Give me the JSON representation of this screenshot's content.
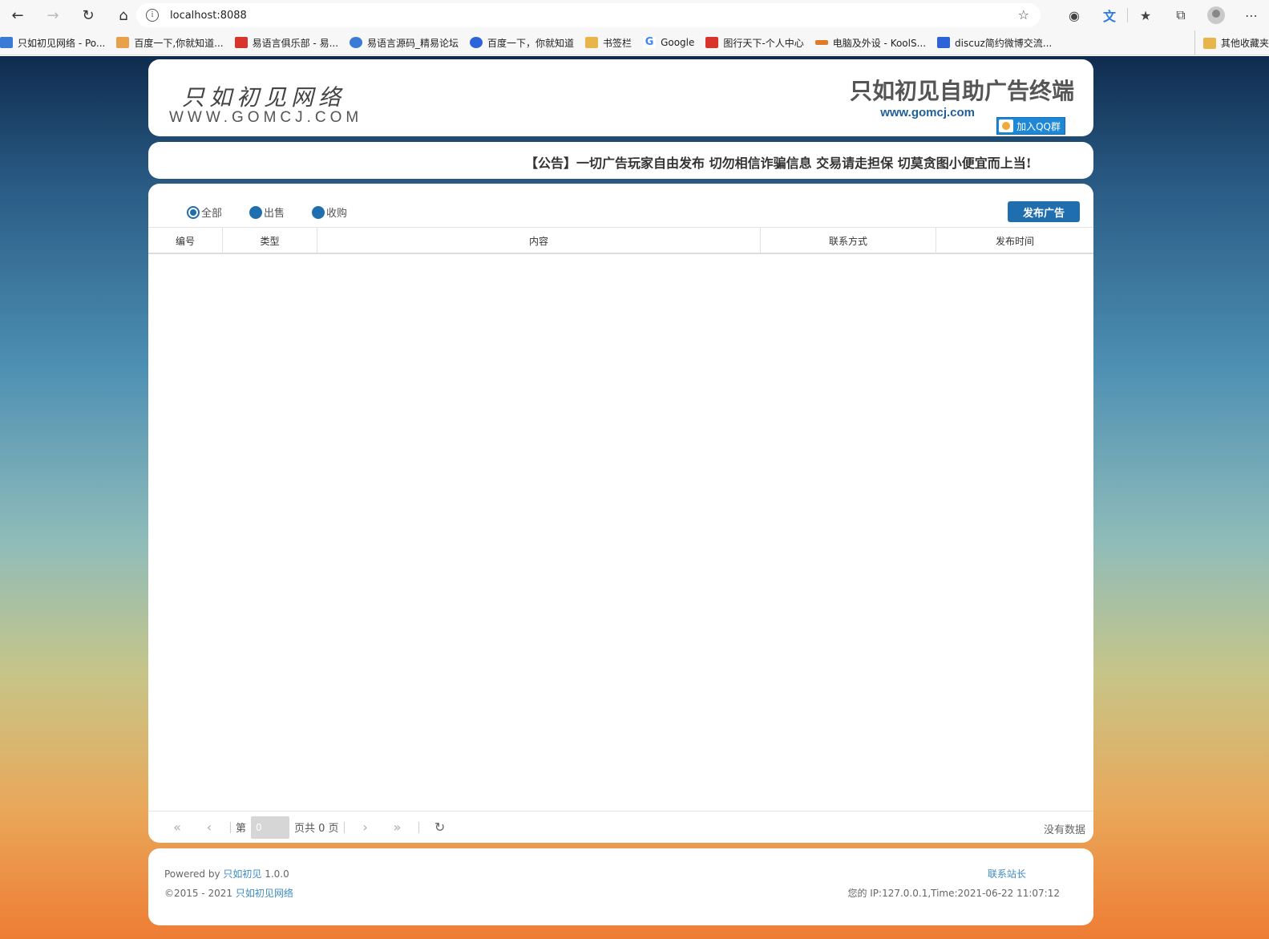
{
  "browser": {
    "url": "localhost:8088",
    "bookmarks": [
      {
        "label": "只如初见网络 - Po...",
        "icon": "site-icon",
        "color": "#3a7bd5"
      },
      {
        "label": "百度一下,你就知道...",
        "icon": "baidu-icon",
        "color": "#e8a04a"
      },
      {
        "label": "易语言俱乐部 - 易...",
        "icon": "club-icon",
        "color": "#d9342b"
      },
      {
        "label": "易语言源码_精易论坛",
        "icon": "eye-icon",
        "color": "#3a7bd5"
      },
      {
        "label": "百度一下，你就知道",
        "icon": "paw-icon",
        "color": "#2d63d8"
      },
      {
        "label": "书签栏",
        "icon": "folder-icon",
        "color": "#e8b54a"
      },
      {
        "label": "Google",
        "icon": "google-icon",
        "color": "#4285f4"
      },
      {
        "label": "图行天下-个人中心",
        "icon": "image-icon",
        "color": "#d9342b"
      },
      {
        "label": "电脑及外设 - KoolS...",
        "icon": "kool-icon",
        "color": "#e07b2a"
      },
      {
        "label": "discuz简约微博交流...",
        "icon": "discuz-icon",
        "color": "#2d63d8"
      }
    ],
    "other_bookmarks": "其他收藏夹"
  },
  "header": {
    "logo_cn": "只如初见网络",
    "logo_en": "WWW.GOMCJ.COM",
    "title": "只如初见自助广告终端",
    "url": "www.gomcj.com",
    "qq_button": "加入QQ群"
  },
  "notice": "【公告】一切广告玩家自由发布 切勿相信诈骗信息 交易请走担保 切莫贪图小便宜而上当!",
  "filters": [
    {
      "label": "全部",
      "selected": true
    },
    {
      "label": "出售",
      "selected": false
    },
    {
      "label": "收购",
      "selected": false
    }
  ],
  "publish_button": "发布广告",
  "table": {
    "columns": [
      "编号",
      "类型",
      "内容",
      "联系方式",
      "发布时间"
    ]
  },
  "pager": {
    "first_label": "第",
    "page_value": "0",
    "total_label": "页共 0 页",
    "status": "没有数据"
  },
  "footer": {
    "powered_prefix": "Powered by ",
    "powered_link": "只如初见",
    "version": " 1.0.0",
    "copyright_prefix": "©2015 - 2021 ",
    "copyright_link": "只如初见网络",
    "contact": "联系站长",
    "ip_info": "您的 IP:127.0.0.1,Time:2021-06-22 11:07:12"
  }
}
